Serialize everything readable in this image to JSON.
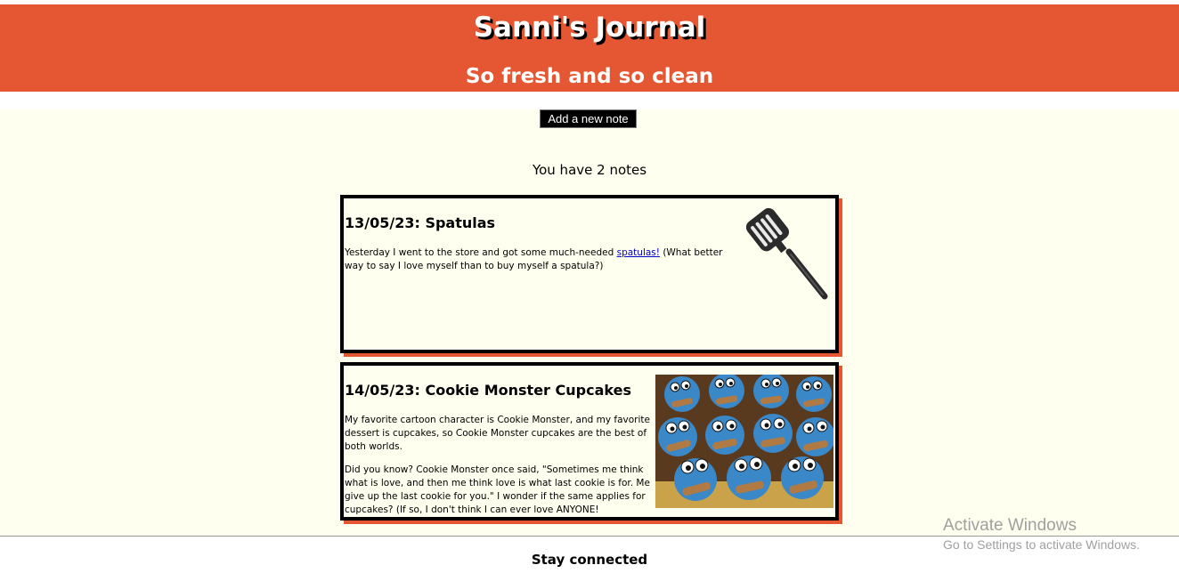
{
  "header": {
    "title": "Sanni's Journal",
    "subtitle": "So fresh and so clean",
    "background_color": "#e45732"
  },
  "actions": {
    "add_note_label": "Add a new note"
  },
  "summary": {
    "note_count_text": "You have 2 notes"
  },
  "notes": [
    {
      "title": "13/05/23: Spatulas",
      "body_before_link": "Yesterday I went to the store and got some much-needed ",
      "link_text": "spatulas!",
      "body_after_link": " (What better way to say I love myself than to buy myself a spatula?)",
      "image": "spatula-image"
    },
    {
      "title": "14/05/23: Cookie Monster Cupcakes",
      "paragraph_1": "My favorite cartoon character is Cookie Monster, and my favorite dessert is cupcakes, so Cookie Monster cupcakes are the best of both worlds.",
      "paragraph_2": "Did you know? Cookie Monster once said, \"Sometimes me think what is love, and then me think love is what last cookie is for. Me give up the last cookie for you.\" I wonder if the same applies for cupcakes? (If so, I don't think I can ever love ANYONE!",
      "image": "cookie-monster-cupcakes-image"
    }
  ],
  "footer": {
    "title": "Stay connected"
  },
  "watermark": {
    "title": "Activate Windows",
    "subtitle": "Go to Settings to activate Windows."
  }
}
